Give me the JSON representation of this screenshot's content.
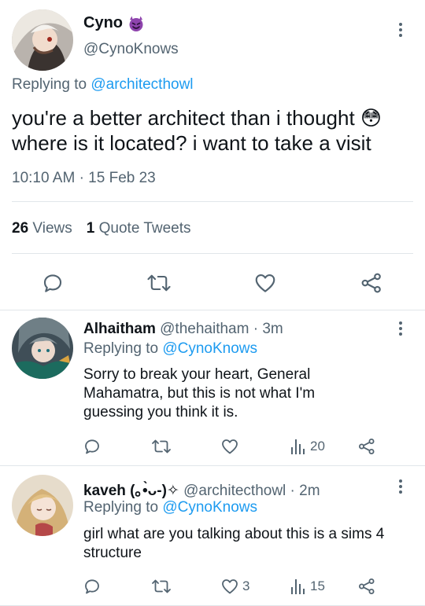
{
  "main_tweet": {
    "author_name": "Cyno",
    "author_emoji": "😈",
    "handle": "@CynoKnows",
    "replying_prefix": "Replying to",
    "replying_to": "@architecthowl",
    "text_line1": "you're a better architect than i thought 😳",
    "text_line2": "where is it located? i want to take a visit",
    "time": "10:10 AM",
    "separator": "·",
    "date": "15 Feb 23",
    "views_count": "26",
    "views_label": "Views",
    "quotes_count": "1",
    "quotes_label": "Quote Tweets"
  },
  "replies": [
    {
      "author_name": "Alhaitham",
      "handle": "@thehaitham",
      "age": "· 3m",
      "replying_prefix": "Replying to",
      "replying_to": "@CynoKnows",
      "text": "Sorry to break your heart, General Mahamatra, but this is not what I'm guessing you think it is.",
      "likes": "",
      "views": "20"
    },
    {
      "author_name": "kaveh (｡•̀ᴗ-)✧",
      "handle": "@architecthowl",
      "age": "· 2m",
      "replying_prefix": "Replying to",
      "replying_to": "@CynoKnows",
      "text": "girl what are you talking about this is a sims 4 structure",
      "likes": "3",
      "views": "15"
    }
  ],
  "colors": {
    "accent": "#1d9bf0",
    "muted": "#536471",
    "text": "#0f1419",
    "emoji_devil": "#8e44ad"
  }
}
